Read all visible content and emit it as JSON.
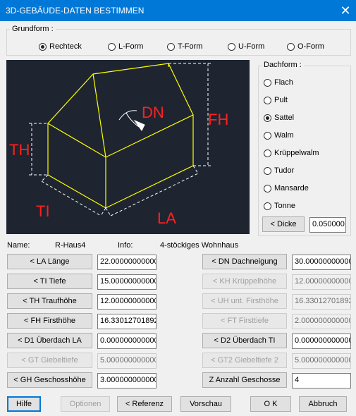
{
  "window": {
    "title": "3D-GEBÄUDE-DATEN BESTIMMEN",
    "close_glyph": "✕"
  },
  "grundform": {
    "label": "Grundform :",
    "options": [
      "Rechteck",
      "L-Form",
      "T-Form",
      "U-Form",
      "O-Form"
    ],
    "selected": "Rechteck"
  },
  "dachform": {
    "label": "Dachform :",
    "options": [
      "Flach",
      "Pult",
      "Sattel",
      "Walm",
      "Krüppelwalm",
      "Tudor",
      "Mansarde",
      "Tonne"
    ],
    "selected": "Sattel",
    "dicke_label": "< Dicke",
    "dicke_value": "0.050000"
  },
  "preview": {
    "labels": {
      "dn": "DN",
      "fh": "FH",
      "th": "TH",
      "ti": "TI",
      "la": "LA"
    },
    "line_color": "#ffff00",
    "label_color": "#ff2020"
  },
  "info": {
    "name_label": "Name:",
    "name_value": "R-Haus4",
    "info_label": "Info:",
    "info_value": "4-stöckiges Wohnhaus"
  },
  "left_params": [
    {
      "label": "< LA Länge",
      "value": "22.00000000000",
      "enabled": true
    },
    {
      "label": "< TI Tiefe",
      "value": "15.00000000000",
      "enabled": true
    },
    {
      "label": "< TH Traufhöhe",
      "value": "12.00000000000",
      "enabled": true
    },
    {
      "label": "< FH Firsthöhe",
      "value": "16.33012701892",
      "enabled": true
    },
    {
      "label": "< D1 Überdach LA",
      "value": "0.000000000000",
      "enabled": true
    },
    {
      "label": "< GT Giebeltiefe",
      "value": "5.000000000000",
      "enabled": false
    },
    {
      "label": "< GH Geschosshöhe",
      "value": "3.000000000000",
      "enabled": true
    }
  ],
  "right_params": [
    {
      "label": "< DN Dachneigung",
      "value": "30.00000000000",
      "enabled": true
    },
    {
      "label": "< KH Krüppelhöhe",
      "value": "12.00000000000",
      "enabled": false
    },
    {
      "label": "< UH unt. Firsthöhe",
      "value": "16.33012701892",
      "enabled": false
    },
    {
      "label": "< FT Firsttiefe",
      "value": "2.000000000000",
      "enabled": false
    },
    {
      "label": "< D2 Überdach TI",
      "value": "0.000000000000",
      "enabled": true
    },
    {
      "label": "< GT2 Giebeltiefe 2",
      "value": "5.000000000000",
      "enabled": false
    },
    {
      "label": "Z Anzahl Geschosse",
      "value": "4",
      "enabled": true
    }
  ],
  "footer": {
    "hilfe": "Hilfe",
    "optionen": "Optionen",
    "referenz": "< Referenz",
    "vorschau": "Vorschau",
    "ok": "O K",
    "abbruch": "Abbruch"
  }
}
